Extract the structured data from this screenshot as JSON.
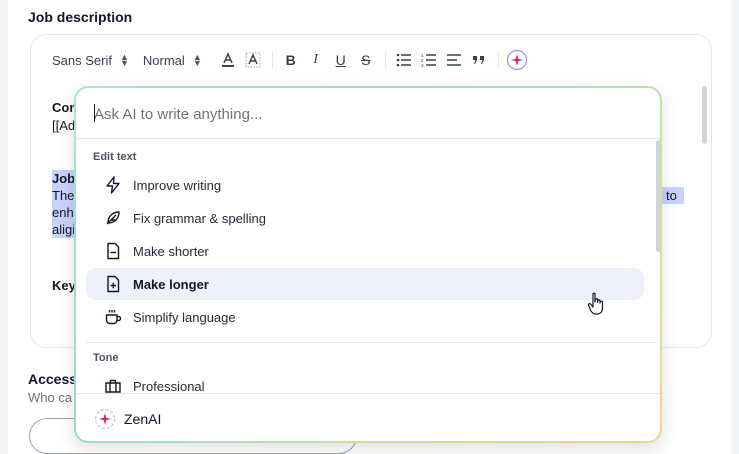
{
  "section": {
    "title": "Job description"
  },
  "toolbar": {
    "font_family": "Sans Serif",
    "font_size": "Normal",
    "buttons": [
      "font-color",
      "highlight",
      "bold",
      "italic",
      "underline",
      "strikethrough",
      "bullet-list",
      "ordered-list",
      "align",
      "quote",
      "ai-sparkle"
    ]
  },
  "editor": {
    "line1_bold": "Com",
    "line2": "[[Ad",
    "line3_bold": "Job",
    "line4": "The",
    "line5": "enh",
    "line6": "aligi",
    "line4_right": "to",
    "line7_bold": "Key"
  },
  "access": {
    "title": "Access",
    "subtitle": "Who ca"
  },
  "ai": {
    "placeholder": "Ask AI to write anything...",
    "groups": [
      {
        "label": "Edit text"
      },
      {
        "label": "Tone"
      }
    ],
    "items": [
      {
        "label": "Improve writing",
        "icon": "lightning-icon"
      },
      {
        "label": "Fix grammar & spelling",
        "icon": "feather-icon"
      },
      {
        "label": "Make shorter",
        "icon": "document-minus-icon"
      },
      {
        "label": "Make longer",
        "icon": "document-plus-icon",
        "active": true
      },
      {
        "label": "Simplify language",
        "icon": "coffee-cup-icon"
      },
      {
        "label": "Professional",
        "icon": "briefcase-icon"
      }
    ],
    "footer": "ZenAI"
  },
  "colors": {
    "highlight": "#c7d2fe",
    "active_item": "#eef0fa",
    "accent_purple": "#7c3aed",
    "accent_pink": "#db2777"
  }
}
